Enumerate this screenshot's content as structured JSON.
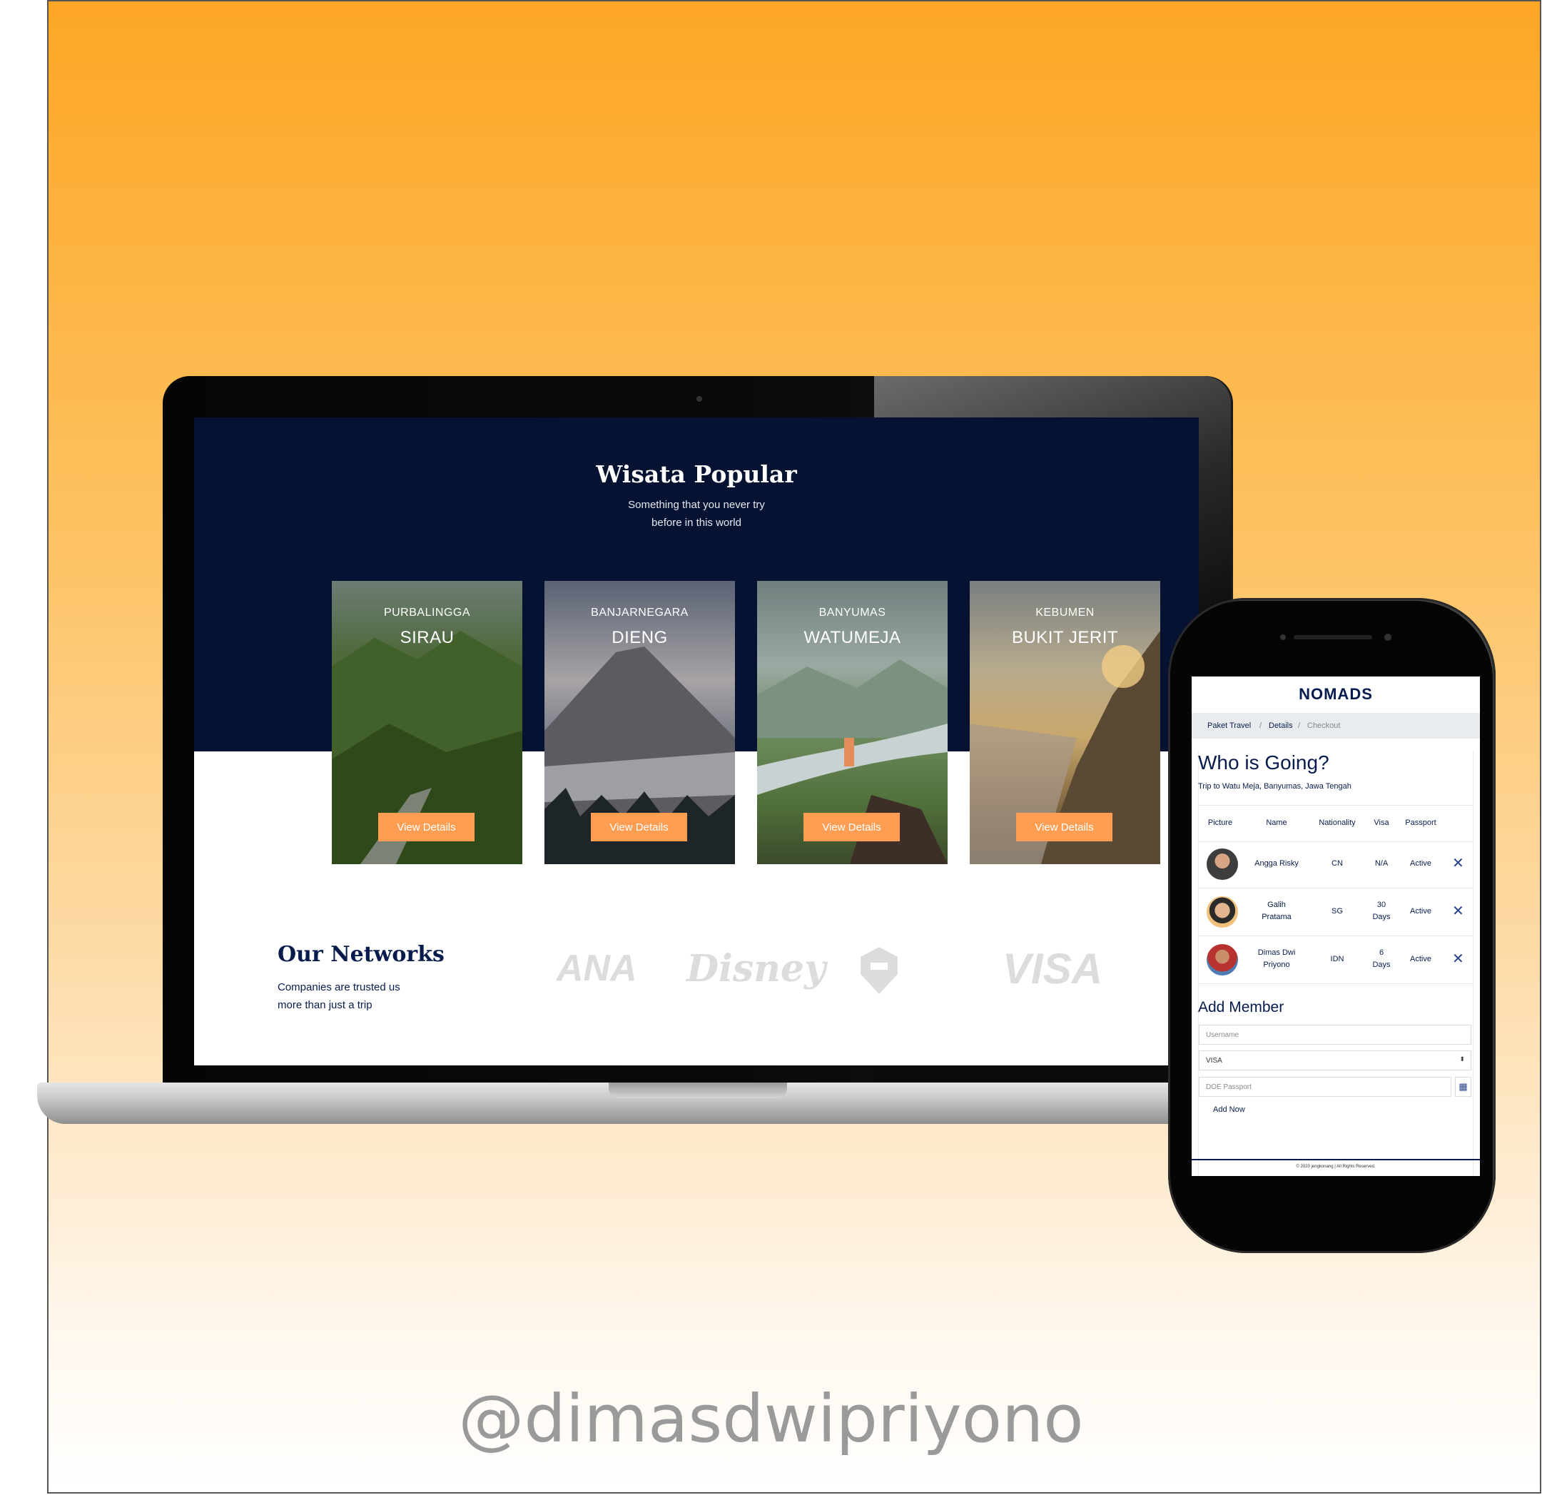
{
  "desktop": {
    "section_title": "Wisata Popular",
    "section_subtitle_line1": "Something that you never try",
    "section_subtitle_line2": "before in this world",
    "cards": [
      {
        "city": "PURBALINGGA",
        "name": "SIRAU",
        "button": "View Details",
        "image": "hill-road-photo"
      },
      {
        "city": "BANJARNEGARA",
        "name": "DIENG",
        "button": "View Details",
        "image": "volcano-mist-photo"
      },
      {
        "city": "BANYUMAS",
        "name": "WATUMEJA",
        "button": "View Details",
        "image": "river-valley-photo"
      },
      {
        "city": "KEBUMEN",
        "name": "BUKIT JERIT",
        "button": "View Details",
        "image": "coastal-cliff-photo"
      }
    ],
    "networks_title": "Our Networks",
    "networks_sub_line1": "Companies are trusted us",
    "networks_sub_line2": "more than just a trip",
    "partner_logos": [
      "ANA",
      "Disney",
      "shield-logo",
      "VISA"
    ]
  },
  "mobile": {
    "brand": "NOMADS",
    "breadcrumb": [
      "Paket Travel",
      "Details",
      "Checkout"
    ],
    "title": "Who is Going?",
    "trip": "Trip to Watu Meja, Banyumas, Jawa Tengah",
    "table_headers": [
      "Picture",
      "Name",
      "Nationality",
      "Visa",
      "Passport"
    ],
    "members": [
      {
        "name_line1": "Angga Risky",
        "name_line2": "",
        "nationality": "CN",
        "visa_line1": "N/A",
        "visa_line2": "",
        "passport": "Active"
      },
      {
        "name_line1": "Galih",
        "name_line2": "Pratama",
        "nationality": "SG",
        "visa_line1": "30",
        "visa_line2": "Days",
        "passport": "Active"
      },
      {
        "name_line1": "Dimas Dwi",
        "name_line2": "Priyono",
        "nationality": "IDN",
        "visa_line1": "6",
        "visa_line2": "Days",
        "passport": "Active"
      }
    ],
    "add_member_title": "Add Member",
    "username_placeholder": "Username",
    "visa_select_value": "VISA",
    "doe_placeholder": "DOE Passport",
    "add_now": "Add Now",
    "footer": "© 2020 jengkonang | All Rights Reserved."
  },
  "watermark": "@dimasdwipriyono",
  "colors": {
    "navy": "#061231",
    "accent": "#ff9e53",
    "text_navy": "#071c4d"
  }
}
